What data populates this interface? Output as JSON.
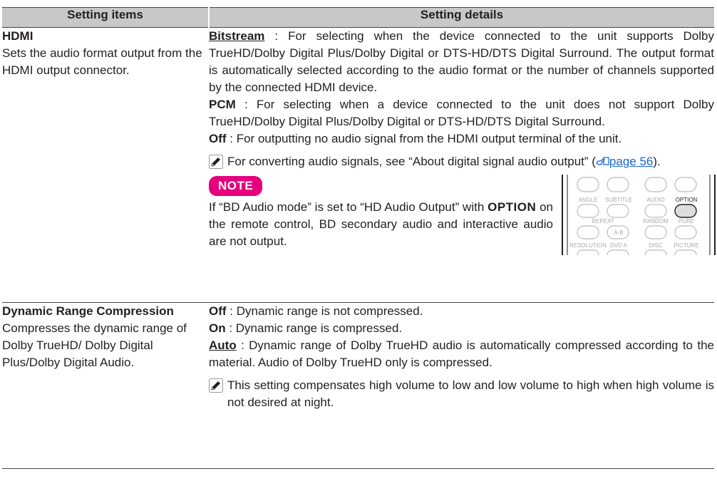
{
  "header": {
    "col1": "Setting items",
    "col2": "Setting details"
  },
  "rows": [
    {
      "name": "HDMI",
      "desc": "Sets the audio format output from the HDMI output connector.",
      "options": [
        {
          "label": "Bitstream",
          "text": " : For selecting when the device connected to the unit supports Dolby TrueHD/Dolby Digital Plus/Dolby Digital or DTS-HD/DTS Digital Surround. The output format is automatically selected according to the audio format or the number of channels supported by the connected HDMI device."
        },
        {
          "label": "PCM",
          "text": " : For selecting when a device connected to the unit does not support Dolby TrueHD/Dolby Digital Plus/Dolby Digital or DTS-HD/DTS Digital Surround."
        },
        {
          "label": "Off",
          "text": " : For outputting no audio signal from the HDMI output terminal of the unit."
        }
      ],
      "hint": {
        "text": "For converting audio signals, see “About digital signal audio output” (",
        "link": "page 56",
        "end": ")."
      },
      "note": {
        "badge": "NOTE",
        "text1": "If “BD Audio mode” is set to “HD Audio Output” with ",
        "bold": "OPTION",
        "text2": " on the remote control, BD secondary audio and interactive audio are not output."
      },
      "remote": {
        "labels": [
          "ANGLE",
          "SUBTITLE",
          "AUDIO",
          "OPTION",
          "REPEAT",
          "RANDOM",
          "PURE",
          "A-B",
          "RESOLUTION",
          "DVD A",
          "DISC",
          "PICTURE"
        ]
      }
    },
    {
      "name": "Dynamic Range Compression",
      "desc": "Compresses the dynamic range of Dolby TrueHD/ Dolby Digital Plus/Dolby Digital Audio.",
      "options": [
        {
          "label": "Off",
          "text": " : Dynamic range is not compressed."
        },
        {
          "label": "On",
          "text": " : Dynamic range is compressed."
        },
        {
          "label": "Auto",
          "text": " : Dynamic range of Dolby TrueHD audio is automatically compressed according to the material. Audio of Dolby TrueHD only is compressed."
        }
      ],
      "hint": {
        "text": "This setting compensates high volume to low and low volume to high when high volume is not desired at night."
      }
    }
  ]
}
